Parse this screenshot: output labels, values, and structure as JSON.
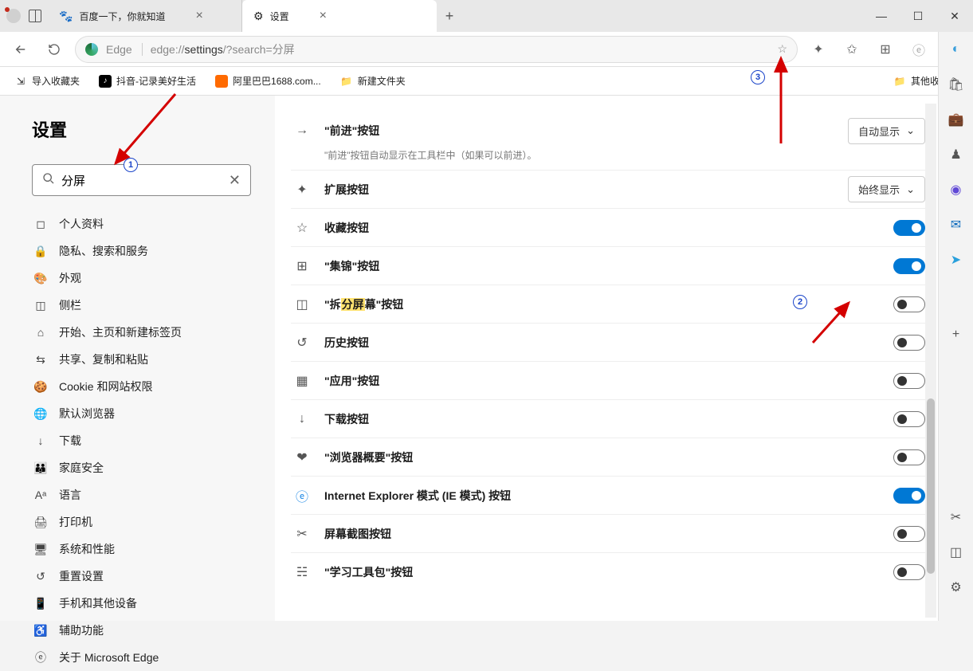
{
  "titlebar": {
    "tab_baidu": "百度一下，你就知道",
    "tab_settings": "设置",
    "new_tab": "+"
  },
  "toolbar": {
    "edge_label": "Edge",
    "url_prefix": "edge://",
    "url_mid": "settings",
    "url_suffix": "/?search=分屏"
  },
  "bookmarks": {
    "import": "导入收藏夹",
    "douyin": "抖音-记录美好生活",
    "alibaba": "阿里巴巴1688.com...",
    "folder1": "新建文件夹",
    "other": "其他收藏夹"
  },
  "sidebar": {
    "title": "设置",
    "search_value": "分屏",
    "items": [
      "个人资料",
      "隐私、搜索和服务",
      "外观",
      "侧栏",
      "开始、主页和新建标签页",
      "共享、复制和粘贴",
      "Cookie 和网站权限",
      "默认浏览器",
      "下载",
      "家庭安全",
      "语言",
      "打印机",
      "系统和性能",
      "重置设置",
      "手机和其他设备",
      "辅助功能",
      "关于 Microsoft Edge"
    ]
  },
  "settings": {
    "forward": {
      "label": "\"前进\"按钮",
      "desc": "\"前进\"按钮自动显示在工具栏中（如果可以前进）。",
      "dropdown": "自动显示"
    },
    "extensions": {
      "label": "扩展按钮",
      "dropdown": "始终显示"
    },
    "favorites": {
      "label": "收藏按钮"
    },
    "collections": {
      "label": "\"集锦\"按钮"
    },
    "split": {
      "prefix": "\"拆",
      "hl": "分屏",
      "suffix": "幕\"按钮"
    },
    "history": {
      "label": "历史按钮"
    },
    "apps": {
      "label": "\"应用\"按钮"
    },
    "download": {
      "label": "下载按钮"
    },
    "overview": {
      "label": "\"浏览器概要\"按钮"
    },
    "ie": {
      "label": "Internet Explorer 模式 (IE 模式) 按钮"
    },
    "screenshot": {
      "label": "屏幕截图按钮"
    },
    "toolkit": {
      "label": "\"学习工具包\"按钮"
    }
  },
  "annotations": {
    "b1": "1",
    "b2": "2",
    "b3": "3"
  }
}
